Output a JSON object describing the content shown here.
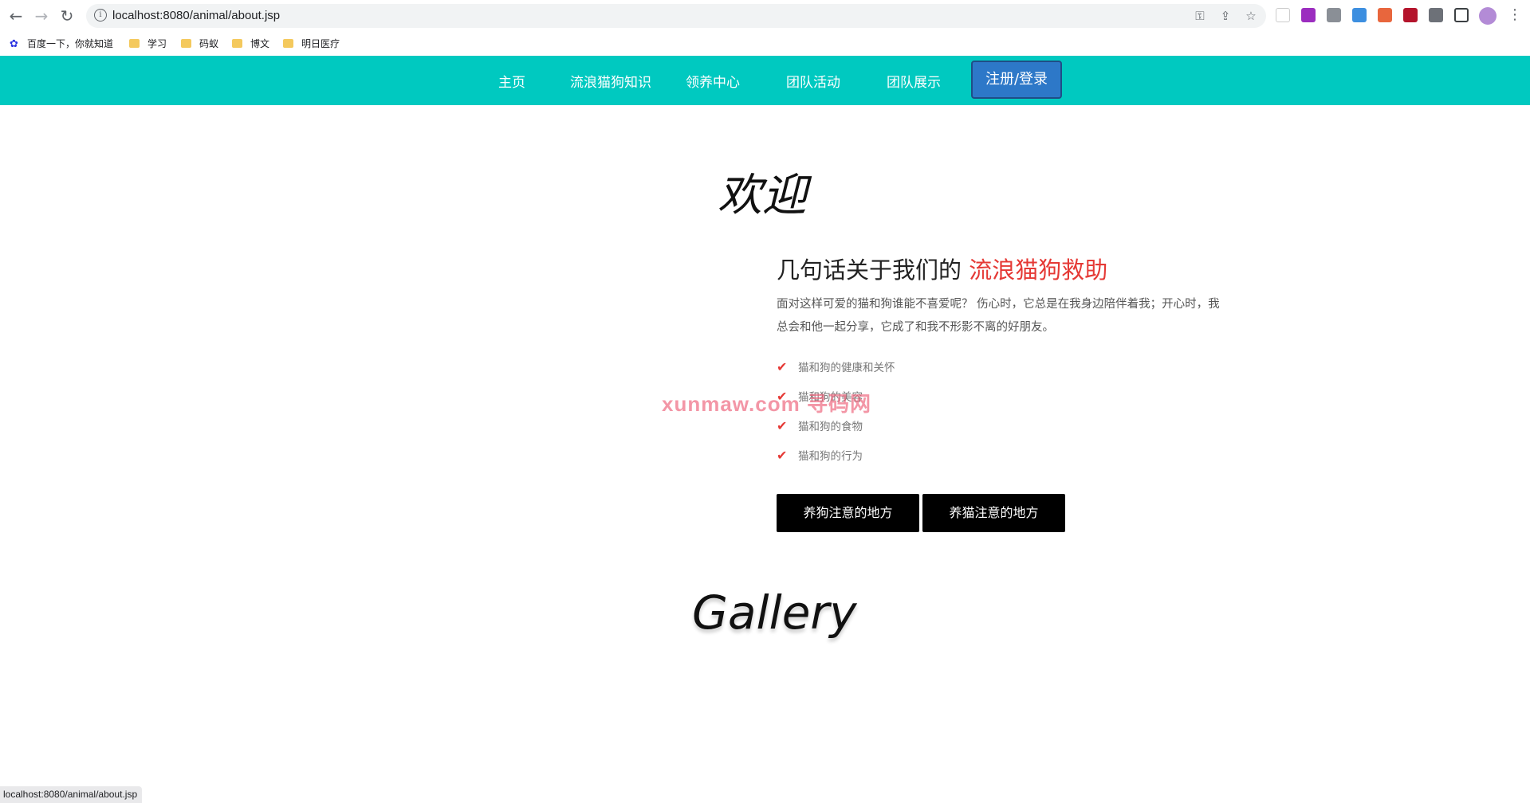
{
  "browser": {
    "url": "localhost:8080/animal/about.jsp",
    "bookmarks": [
      "百度一下，你就知道",
      "学习",
      "码蚁",
      "博文",
      "明日医疗"
    ]
  },
  "nav": {
    "items": [
      "主页",
      "流浪猫狗知识",
      "领养中心",
      "团队活动",
      "团队展示"
    ],
    "login_label": "注册/登录"
  },
  "main": {
    "welcome": "欢迎",
    "about_title_prefix": "几句话关于我们的",
    "about_title_accent": "流浪猫狗救助",
    "paragraph": "面对这样可爱的猫和狗谁能不喜爱呢？ 伤心时，它总是在我身边陪伴着我；开心时，我总会和他一起分享，它成了和我不形影不离的好朋友。",
    "features": [
      "猫和狗的健康和关怀",
      "猫和狗的美容",
      "猫和狗的食物",
      "猫和狗的行为"
    ],
    "button_dog": "养狗注意的地方",
    "button_cat": "养猫注意的地方",
    "gallery_title": "Gallery"
  },
  "watermark": "xunmaw.com 寻码网",
  "status_url": "localhost:8080/animal/about.jsp",
  "colors": {
    "nav_bg": "#00c9c0",
    "accent": "#e53935",
    "login_bg": "#2d78c8"
  }
}
